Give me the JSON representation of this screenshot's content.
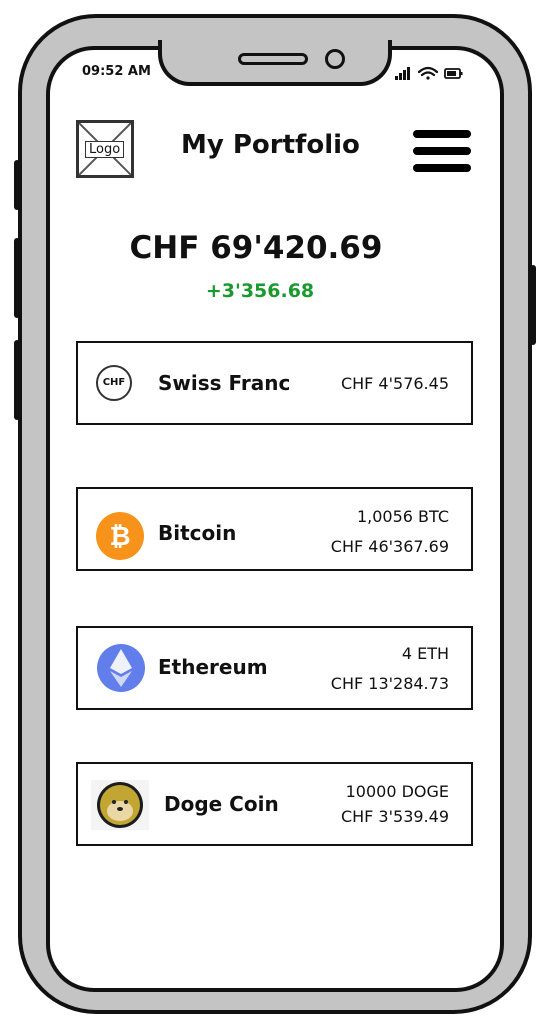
{
  "status": {
    "time": "09:52 AM"
  },
  "header": {
    "logo_label": "Logo",
    "title": "My Portfolio"
  },
  "portfolio": {
    "total": "CHF 69'420.69",
    "change": "+3'356.68",
    "change_color": "#1a9a2e"
  },
  "assets": [
    {
      "name": "Swiss Franc",
      "icon": "chf-coin-icon",
      "icon_text": "CHF",
      "amount": "",
      "value": "CHF 4'576.45"
    },
    {
      "name": "Bitcoin",
      "icon": "bitcoin-icon",
      "icon_color": "#f7931a",
      "amount": "1,0056 BTC",
      "value": "CHF 46'367.69"
    },
    {
      "name": "Ethereum",
      "icon": "ethereum-icon",
      "icon_color": "#627eea",
      "amount": "4 ETH",
      "value": "CHF 13'284.73"
    },
    {
      "name": "Doge Coin",
      "icon": "dogecoin-icon",
      "icon_color": "#c2a633",
      "amount": "10000 DOGE",
      "value": "CHF 3'539.49"
    }
  ]
}
